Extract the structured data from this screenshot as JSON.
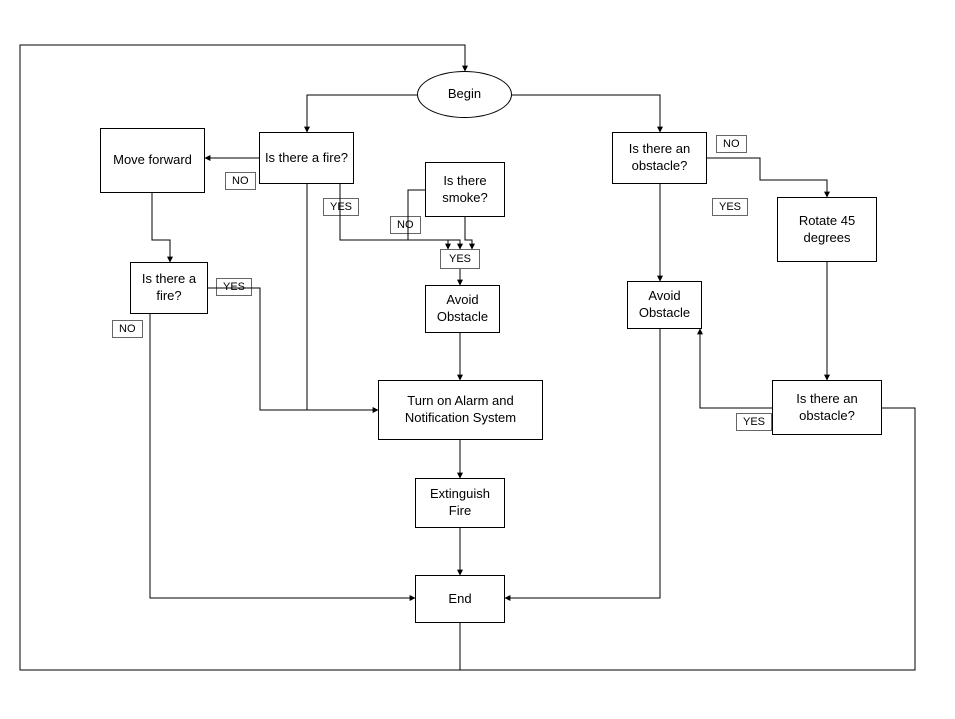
{
  "nodes": {
    "begin": "Begin",
    "fire1": "Is there a fire?",
    "obstacle1": "Is there an obstacle?",
    "moveforward": "Move forward",
    "smoke": "Is there smoke?",
    "rotate": "Rotate 45 degrees",
    "fire2": "Is there a fire?",
    "avoid1": "Avoid Obstacle",
    "avoid2": "Avoid Obstacle",
    "obstacle2": "Is there an obstacle?",
    "alarm": "Turn on Alarm and Notification System",
    "extinguish": "Extinguish Fire",
    "end": "End"
  },
  "labels": {
    "no": "NO",
    "yes": "YES"
  }
}
